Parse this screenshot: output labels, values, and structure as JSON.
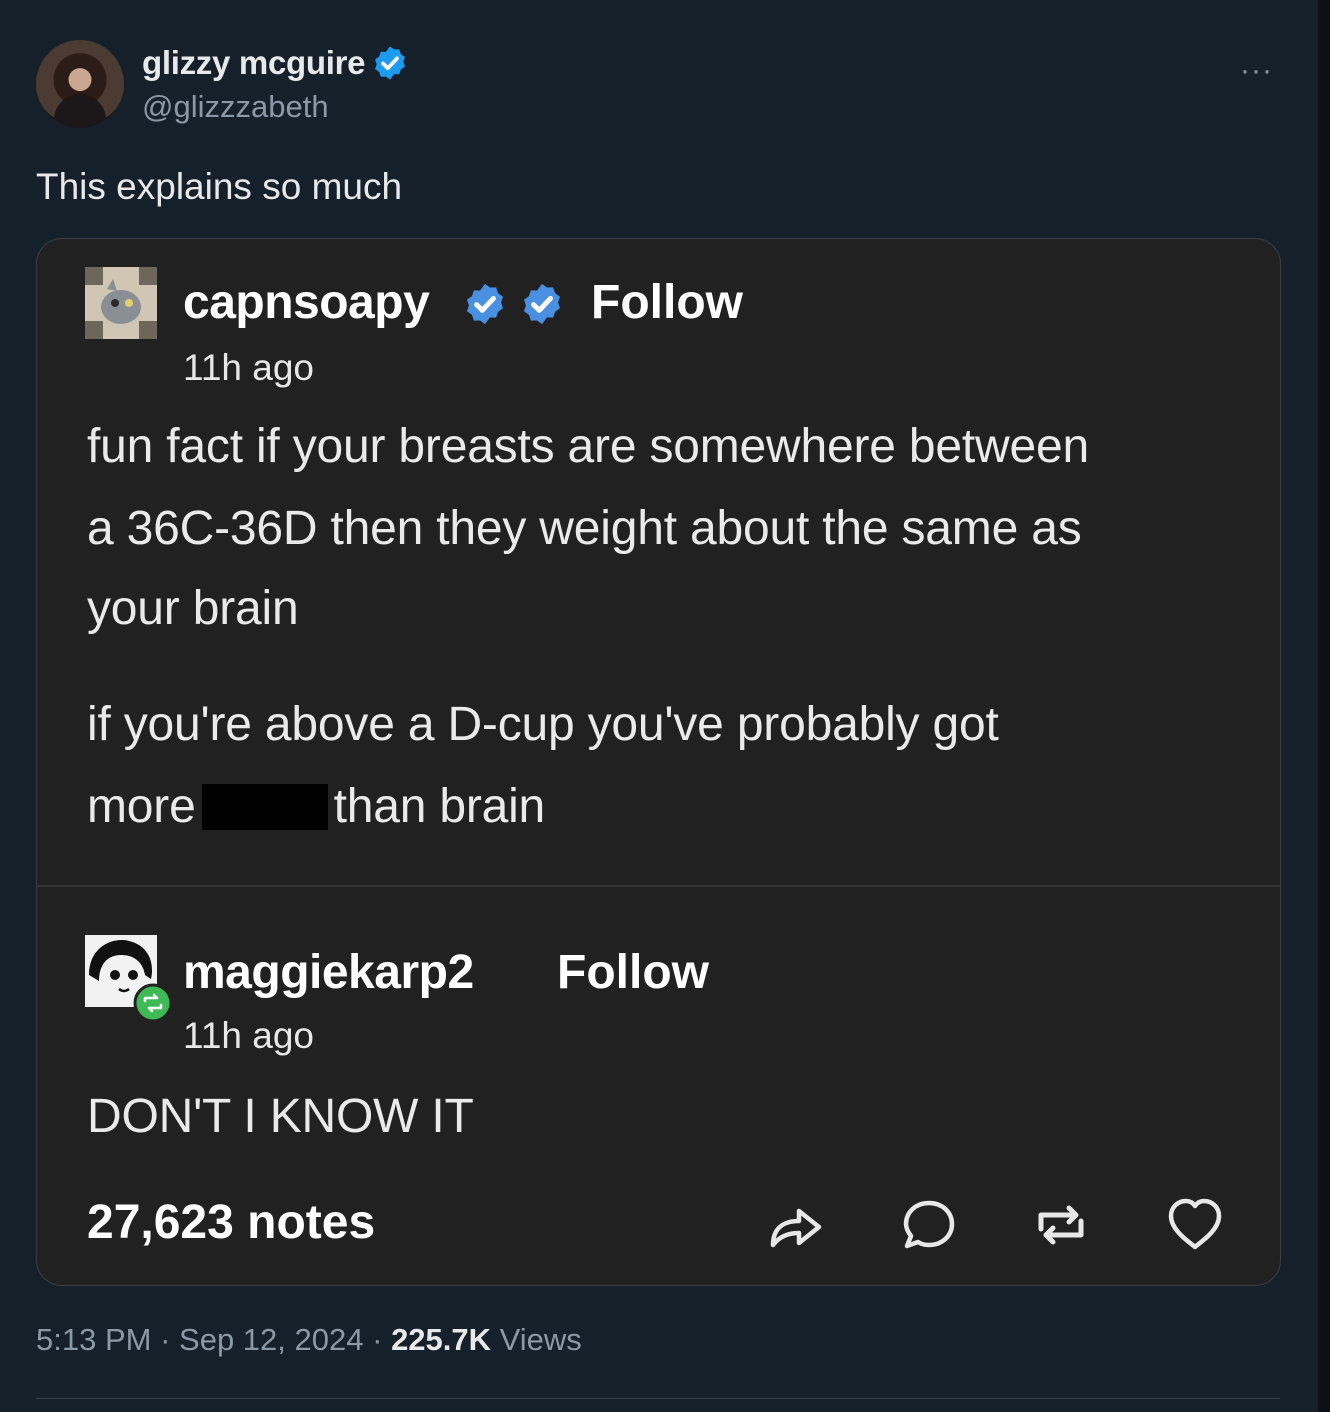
{
  "tweet": {
    "author_name": "glizzy mcguire",
    "author_handle": "@glizzzabeth",
    "text": "This explains so much",
    "time": "5:13 PM",
    "date": "Sep 12, 2024",
    "views_count": "225.7K",
    "views_label": "Views",
    "separator": "·",
    "more_label": "···"
  },
  "embedded_post": {
    "original": {
      "username": "capnsoapy",
      "follow_label": "Follow",
      "time_ago": "11h ago",
      "line1": "fun fact if your breasts are somewhere between",
      "line2": "a 36C-36D then they weight about the same as",
      "line3": "your brain",
      "line4": "if you're above a D-cup you've probably got",
      "line5_before": "more",
      "line5_after": "than brain"
    },
    "reblog": {
      "username": "maggiekarp2",
      "follow_label": "Follow",
      "time_ago": "11h ago",
      "text": "DON'T I KNOW IT"
    },
    "notes": "27,623 notes"
  },
  "colors": {
    "background": "#15202b",
    "card": "#212121",
    "verified_blue": "#1d9bf0",
    "tumblr_blue": "#4a90e2",
    "reblog_green": "#3dba55",
    "muted": "#8b98a5"
  },
  "icons": [
    "verified-badge-icon",
    "more-icon",
    "share-icon",
    "reply-icon",
    "reblog-icon",
    "heart-icon"
  ]
}
